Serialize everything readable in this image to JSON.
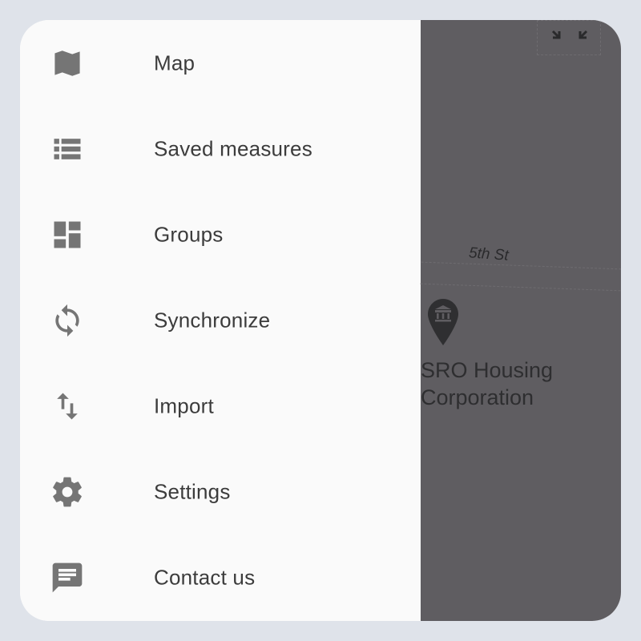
{
  "drawer": {
    "items": [
      {
        "label": "Map",
        "icon": "map-icon"
      },
      {
        "label": "Saved measures",
        "icon": "list-icon"
      },
      {
        "label": "Groups",
        "icon": "dashboard-icon"
      },
      {
        "label": "Synchronize",
        "icon": "sync-icon"
      },
      {
        "label": "Import",
        "icon": "import-export-icon"
      },
      {
        "label": "Settings",
        "icon": "gear-icon"
      },
      {
        "label": "Contact us",
        "icon": "chat-icon"
      }
    ]
  },
  "map": {
    "street_label": "5th St",
    "poi_line1": "SRO Housing",
    "poi_line2": "Corporation",
    "overlay_color": "#5f5d61"
  },
  "colors": {
    "drawer_bg": "#fafafa",
    "icon": "#757575",
    "text": "#3c3c3c"
  }
}
